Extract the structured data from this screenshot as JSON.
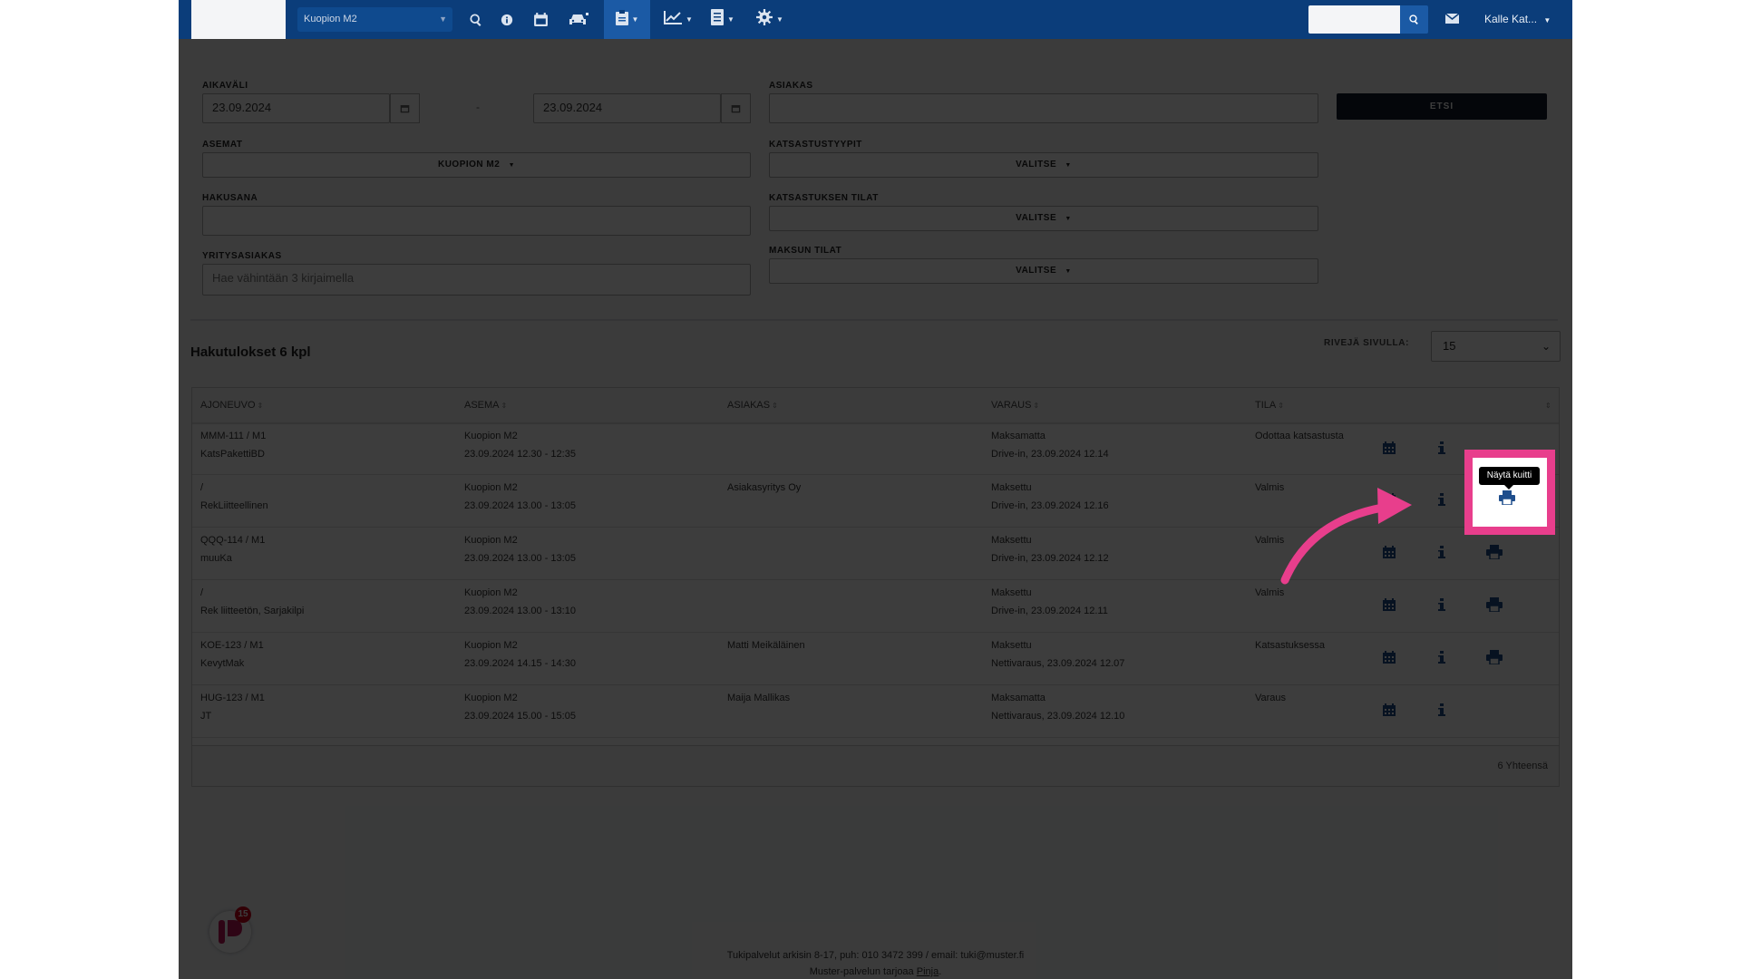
{
  "topbar": {
    "station": "Kuopion M2",
    "user": "Kalle Kat...",
    "icons": [
      "search-icon",
      "info-icon",
      "calendar-icon",
      "car-icon",
      "clipboard-icon",
      "chart-icon",
      "list-icon",
      "gear-icon",
      "mail-icon"
    ]
  },
  "form": {
    "aikavali_label": "AIKAVÄLI",
    "date_from": "23.09.2024",
    "date_to": "23.09.2024",
    "date_sep": "-",
    "asiakas_label": "ASIAKAS",
    "etsi_label": "ETSI",
    "asemat_label": "ASEMAT",
    "asemat_value": "KUOPION M2",
    "katsastustyypit_label": "KATSASTUSTYYPIT",
    "katsastustyypit_value": "VALITSE",
    "hakusana_label": "HAKUSANA",
    "katsastuksen_tilat_label": "KATSASTUKSEN TILAT",
    "katsastuksen_tilat_value": "VALITSE",
    "yritysasiakas_label": "YRITYSASIAKAS",
    "yritysasiakas_placeholder": "Hae vähintään 3 kirjaimella",
    "maksun_tilat_label": "MAKSUN TILAT",
    "maksun_tilat_value": "VALITSE"
  },
  "results": {
    "title": "Hakutulokset 6 kpl",
    "rows_label": "RIVEJÄ SIVULLA:",
    "rows_value": "15",
    "columns": [
      "AJONEUVO",
      "ASEMA",
      "ASIAKAS",
      "VARAUS",
      "TILA"
    ],
    "rows": [
      {
        "vehicle1": "MMM-111 / M1",
        "vehicle2": "KatsPakettiBD",
        "station1": "Kuopion M2",
        "station2": "23.09.2024 12.30 - 12:35",
        "customer": "",
        "booking1": "Maksamatta",
        "booking2": "Drive-in, 23.09.2024 12.14",
        "status": "Odottaa katsastusta"
      },
      {
        "vehicle1": "/",
        "vehicle2": "RekLiitteellinen",
        "station1": "Kuopion M2",
        "station2": "23.09.2024 13.00 - 13:05",
        "customer": "Asiakasyritys Oy",
        "booking1": "Maksettu",
        "booking2": "Drive-in, 23.09.2024 12.16",
        "status": "Valmis"
      },
      {
        "vehicle1": "QQQ-114 / M1",
        "vehicle2": "muuKa",
        "station1": "Kuopion M2",
        "station2": "23.09.2024 13.00 - 13:05",
        "customer": "",
        "booking1": "Maksettu",
        "booking2": "Drive-in, 23.09.2024 12.12",
        "status": "Valmis"
      },
      {
        "vehicle1": "/",
        "vehicle2": "Rek liitteetön, Sarjakilpi",
        "station1": "Kuopion M2",
        "station2": "23.09.2024 13.00 - 13:10",
        "customer": "",
        "booking1": "Maksettu",
        "booking2": "Drive-in, 23.09.2024 12.11",
        "status": "Valmis"
      },
      {
        "vehicle1": "KOE-123 / M1",
        "vehicle2": "KevytMak",
        "station1": "Kuopion M2",
        "station2": "23.09.2024 14.15 - 14:30",
        "customer": "Matti Meikäläinen",
        "booking1": "Maksettu",
        "booking2": "Nettivaraus, 23.09.2024 12.07",
        "status": "Katsastuksessa"
      },
      {
        "vehicle1": "HUG-123 / M1",
        "vehicle2": "JT",
        "station1": "Kuopion M2",
        "station2": "23.09.2024 15.00 - 15:05",
        "customer": "Maija Mallikas",
        "booking1": "Maksamatta",
        "booking2": "Nettivaraus, 23.09.2024 12.10",
        "status": "Varaus"
      }
    ],
    "total": "6 Yhteensä"
  },
  "tooltip": "Näytä kuitti",
  "footer": {
    "line1": "Tukipalvelut arkisin 8-17, puh: 010 3472 399 / email: tuki@muster.fi",
    "line2_prefix": "Muster-palvelun tarjoaa",
    "line2_link": "Pinja",
    "line2_suffix": "."
  },
  "chat": {
    "badge": "15"
  },
  "colors": {
    "navbar": "#0b3d7a",
    "accent": "#1b5aa5",
    "highlight": "#e83e8c",
    "icon": "#1f4e8c"
  }
}
